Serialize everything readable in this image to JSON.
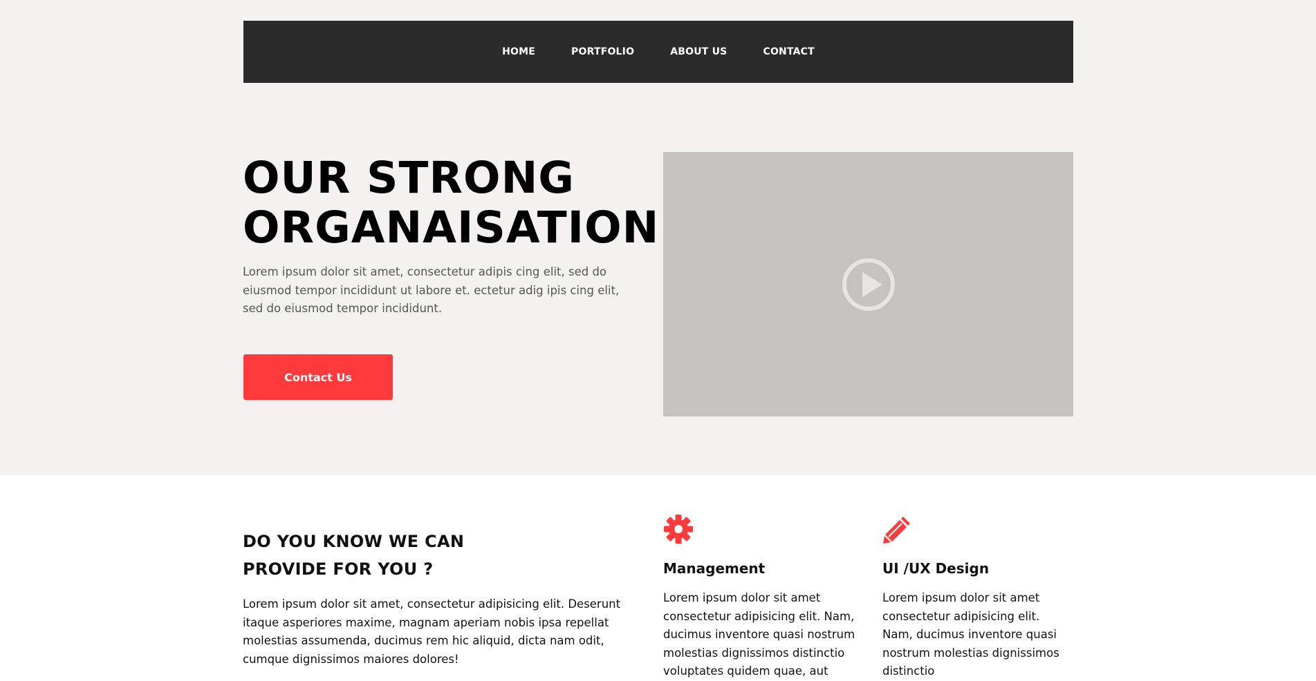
{
  "nav": {
    "items": [
      {
        "label": "HOME"
      },
      {
        "label": "PORTFOLIO"
      },
      {
        "label": "ABOUT US"
      },
      {
        "label": "CONTACT"
      }
    ]
  },
  "hero": {
    "title_line1": "OUR STRONG",
    "title_line2": "ORGANAISATION",
    "text": "Lorem ipsum dolor sit amet, consectetur adipis cing elit, sed do eiusmod tempor incididunt ut labore et. ectetur adig ipis cing elit, sed do eiusmod tempor incididunt.",
    "button_label": "Contact Us"
  },
  "video": {
    "icon": "play-circle-icon"
  },
  "provide": {
    "heading_line1": "DO YOU KNOW WE CAN",
    "heading_line2": "PROVIDE FOR YOU ?",
    "text": "Lorem ipsum dolor sit amet, consectetur adipisicing elit. Deserunt itaque asperiores maxime, magnam aperiam nobis ipsa repellat molestias assumenda, ducimus rem hic aliquid, dicta nam odit, cumque dignissimos maiores dolores!"
  },
  "features": [
    {
      "icon": "gear-icon",
      "title": "Management",
      "text": "Lorem ipsum dolor sit amet consectetur adipisicing elit. Nam, ducimus inventore quasi nostrum molestias dignissimos distinctio voluptates quidem quae, aut"
    },
    {
      "icon": "pencil-icon",
      "title": "UI /UX Design",
      "text": "Lorem ipsum dolor sit amet consectetur adipisicing elit. Nam, ducimus inventore quasi nostrum molestias dignissimos distinctio"
    }
  ],
  "colors": {
    "accent": "#ff3a3c",
    "nav_bg": "#2b2b2b",
    "hero_bg": "#f5f1f0",
    "video_bg": "#c4c3c1"
  }
}
